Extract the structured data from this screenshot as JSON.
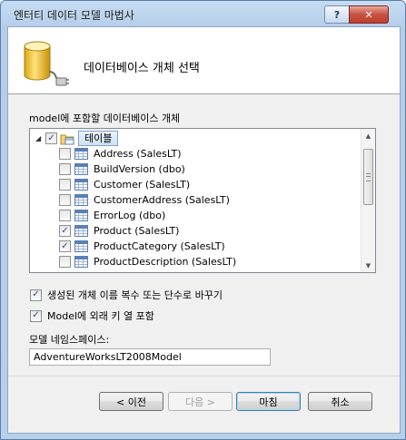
{
  "window": {
    "title": "엔터티 데이터 모델 마법사",
    "help_label": "?",
    "close_label": "✕"
  },
  "header": {
    "title": "데이터베이스 개체 선택"
  },
  "objects": {
    "label": "model에 포함할 데이터베이스 개체",
    "root": {
      "label": "테이블",
      "expanded": true,
      "checked": "partial"
    },
    "items": [
      {
        "label": "Address (SalesLT)",
        "checked": false
      },
      {
        "label": "BuildVersion (dbo)",
        "checked": false
      },
      {
        "label": "Customer (SalesLT)",
        "checked": false
      },
      {
        "label": "CustomerAddress (SalesLT)",
        "checked": false
      },
      {
        "label": "ErrorLog (dbo)",
        "checked": false
      },
      {
        "label": "Product (SalesLT)",
        "checked": true
      },
      {
        "label": "ProductCategory (SalesLT)",
        "checked": true
      },
      {
        "label": "ProductDescription (SalesLT)",
        "checked": false
      }
    ]
  },
  "options": {
    "pluralize": {
      "label": "생성된 개체 이름 복수 또는 단수로 바꾸기",
      "checked": true
    },
    "foreign_keys": {
      "label": "Model에 외래 키 열 포함",
      "checked": true
    }
  },
  "namespace": {
    "label": "모델 네임스페이스:",
    "value": "AdventureWorksLT2008Model"
  },
  "buttons": {
    "prev": "< 이전",
    "next": "다음 >",
    "finish": "마침",
    "cancel": "취소"
  }
}
